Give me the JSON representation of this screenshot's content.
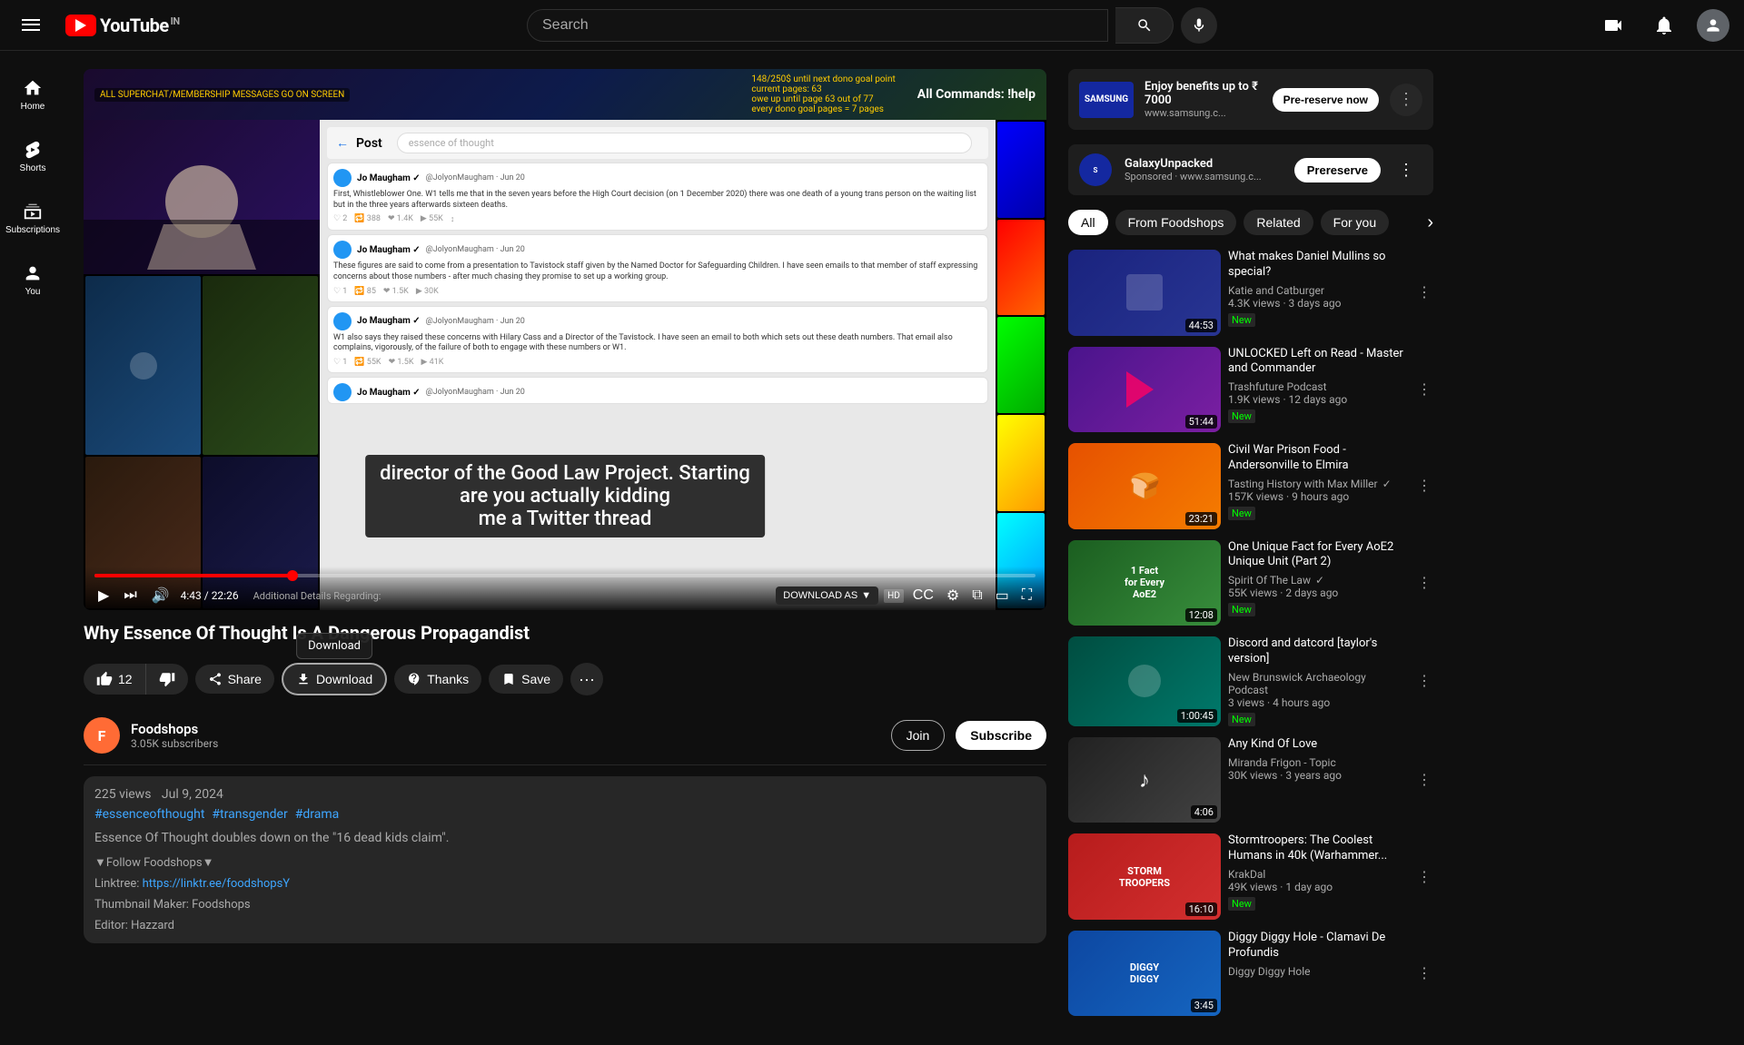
{
  "header": {
    "menu_label": "Menu",
    "logo_text": "YouTube",
    "logo_in": "IN",
    "search_placeholder": "Search",
    "create_label": "Create",
    "notifications_label": "Notifications",
    "account_label": "Account"
  },
  "video": {
    "title": "Why Essence Of Thought Is A Dangerous Propagandist",
    "subtitle_line1": "director of the Good Law Project. Starting",
    "subtitle_line2": "are you actually kidding",
    "subtitle_line3": "me a Twitter thread",
    "channel_name": "Foodshops",
    "channel_subscribers": "3.05K subscribers",
    "join_label": "Join",
    "subscribe_label": "Subscribe",
    "likes": "12",
    "share_label": "Share",
    "download_label": "Download",
    "thanks_label": "Thanks",
    "save_label": "Save",
    "more_label": "More",
    "views": "225 views",
    "date": "Jul 9, 2024",
    "tags": [
      "#essenceofthought",
      "#transgender",
      "#drama"
    ],
    "desc_line1": "Essence Of Thought doubles down on the \"16 dead kids claim\".",
    "follow_label": "▼Follow Foodshops▼",
    "linktree_label": "Linktree:",
    "linktree_url": "https://linktr.ee/foodshopsY",
    "thumbnail_label": "Thumbnail Maker: Foodshops",
    "editor_label": "Editor: Hazzard",
    "time_current": "4:43",
    "time_total": "22:26",
    "progress_percent": 21,
    "download_btn_label": "DOWNLOAD AS",
    "additional_details": "Additional Details Regarding:"
  },
  "post_overlay": {
    "back": "←",
    "title": "Post",
    "author": "Jo Maugham",
    "handle": "@JolyonMaugham",
    "date1": "Jun 20",
    "text1": "First, Whistleblower One. W1 tells me that in the seven years before the High Court decision (on 1 December 2020) there was one death of a young trans person on the waiting list but in the three years afterwards sixteen deaths.",
    "text2": "These figures are said to come from a presentation to Tavistock staff given by the Named Doctor for Safeguarding Children. I have seen emails to that member of staff expressing concerns about those numbers - after much chasing they promise to set up a working group.",
    "text3": "W1 also says they raised these concerns with Hilary Cass and a Director of the Tavistock. I have seen an email to both which sets out these death numbers."
  },
  "sidebar": {
    "ad": {
      "brand": "SAMSUNG",
      "title": "Enjoy benefits up to ₹ 7000",
      "cta": "Pre-reserve now",
      "sponsored_label": "Sponsored",
      "url": "www.samsung.c..."
    },
    "sponsored_channel": {
      "name": "GalaxyUnpacked",
      "url": "www.samsung.c...",
      "cta": "Prereserve"
    },
    "filter_tabs": [
      {
        "id": "all",
        "label": "All",
        "active": true
      },
      {
        "id": "from-foodshops",
        "label": "From Foodshops",
        "active": false
      },
      {
        "id": "related",
        "label": "Related",
        "active": false
      },
      {
        "id": "for-you",
        "label": "For you",
        "active": false
      }
    ],
    "recommended": [
      {
        "title": "What makes Daniel Mullins so special?",
        "channel": "Katie and Catburger",
        "views": "4.3K views",
        "age": "3 days ago",
        "duration": "44:53",
        "badge": "New",
        "thumb_class": "thumb-blue"
      },
      {
        "title": "UNLOCKED Left on Read - Master and Commander",
        "channel": "Trashfuture Podcast",
        "views": "1.9K views",
        "age": "12 days ago",
        "duration": "51:44",
        "badge": "New",
        "thumb_class": "thumb-purple"
      },
      {
        "title": "Civil War Prison Food - Andersonville to Elmira",
        "channel": "Tasting History with Max Miller",
        "views": "157K views",
        "age": "9 hours ago",
        "duration": "23:21",
        "badge": "New",
        "thumb_class": "thumb-orange",
        "verified": true
      },
      {
        "title": "One Unique Fact for Every AoE2 Unique Unit (Part 2)",
        "channel": "Spirit Of The Law",
        "views": "55K views",
        "age": "2 days ago",
        "duration": "12:08",
        "badge": "New",
        "thumb_class": "thumb-green",
        "verified": true
      },
      {
        "title": "Discord and datcord [taylor's version]",
        "channel": "New Brunswick Archaeology Podcast",
        "views": "3 views",
        "age": "4 hours ago",
        "duration": "1:00:45",
        "badge": "New",
        "thumb_class": "thumb-teal"
      },
      {
        "title": "Any Kind Of Love",
        "channel": "Miranda Frigon - Topic",
        "views": "30K views",
        "age": "3 years ago",
        "duration": "4:06",
        "badge": "",
        "thumb_class": "thumb-dark"
      },
      {
        "title": "Stormtroopers: The Coolest Humans in 40k (Warhammer...",
        "channel": "KrakDal",
        "views": "49K views",
        "age": "1 day ago",
        "duration": "16:10",
        "badge": "New",
        "thumb_class": "thumb-red"
      },
      {
        "title": "Diggy Diggy Hole - Clamavi De Profundis",
        "channel": "Diggy Diggy Hole",
        "views": "",
        "age": "",
        "duration": "3:45",
        "badge": "",
        "thumb_class": "thumb-navy"
      }
    ]
  }
}
